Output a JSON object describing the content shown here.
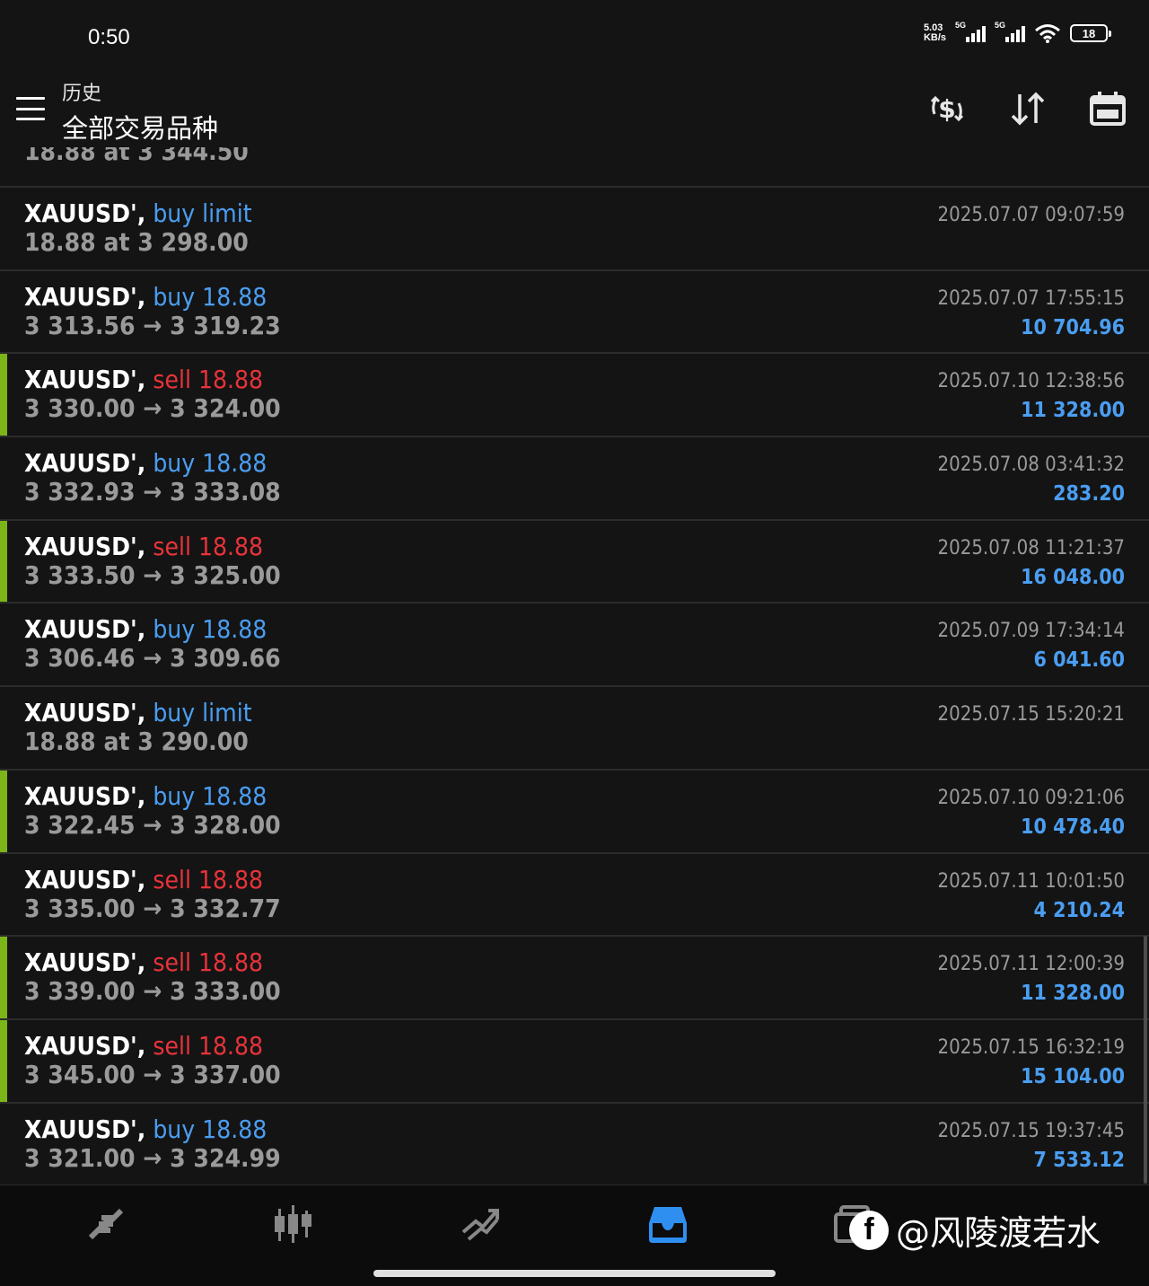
{
  "status_bar": {
    "time": "0:50",
    "net_speed_value": "5.03",
    "net_speed_unit": "KB/s",
    "network_1": "5G",
    "network_2": "5G",
    "battery": "18"
  },
  "header": {
    "subtitle": "历史",
    "title": "全部交易品种",
    "icons": [
      "menu-icon",
      "currency-exchange-icon",
      "sort-icon",
      "calendar-icon"
    ]
  },
  "partial_row": {
    "line2": "18.88 at 3 344.50"
  },
  "rows": [
    {
      "symbol": "XAUUSD',",
      "side": "buy limit",
      "side_type": "buy",
      "line2": "18.88 at 3 298.00",
      "time": "2025.07.07 09:07:59",
      "profit": "",
      "marked": false
    },
    {
      "symbol": "XAUUSD',",
      "side": "buy 18.88",
      "side_type": "buy",
      "line2": "3 313.56 → 3 319.23",
      "time": "2025.07.07 17:55:15",
      "profit": "10 704.96",
      "marked": false
    },
    {
      "symbol": "XAUUSD',",
      "side": "sell 18.88",
      "side_type": "sell",
      "line2": "3 330.00 → 3 324.00",
      "time": "2025.07.10 12:38:56",
      "profit": "11 328.00",
      "marked": true
    },
    {
      "symbol": "XAUUSD',",
      "side": "buy 18.88",
      "side_type": "buy",
      "line2": "3 332.93 → 3 333.08",
      "time": "2025.07.08 03:41:32",
      "profit": "283.20",
      "marked": false
    },
    {
      "symbol": "XAUUSD',",
      "side": "sell 18.88",
      "side_type": "sell",
      "line2": "3 333.50 → 3 325.00",
      "time": "2025.07.08 11:21:37",
      "profit": "16 048.00",
      "marked": true
    },
    {
      "symbol": "XAUUSD',",
      "side": "buy 18.88",
      "side_type": "buy",
      "line2": "3 306.46 → 3 309.66",
      "time": "2025.07.09 17:34:14",
      "profit": "6 041.60",
      "marked": false
    },
    {
      "symbol": "XAUUSD',",
      "side": "buy limit",
      "side_type": "buy",
      "line2": "18.88 at 3 290.00",
      "time": "2025.07.15 15:20:21",
      "profit": "",
      "marked": false
    },
    {
      "symbol": "XAUUSD',",
      "side": "buy 18.88",
      "side_type": "buy",
      "line2": "3 322.45 → 3 328.00",
      "time": "2025.07.10 09:21:06",
      "profit": "10 478.40",
      "marked": true
    },
    {
      "symbol": "XAUUSD',",
      "side": "sell 18.88",
      "side_type": "sell",
      "line2": "3 335.00 → 3 332.77",
      "time": "2025.07.11 10:01:50",
      "profit": "4 210.24",
      "marked": false
    },
    {
      "symbol": "XAUUSD',",
      "side": "sell 18.88",
      "side_type": "sell",
      "line2": "3 339.00 → 3 333.00",
      "time": "2025.07.11 12:00:39",
      "profit": "11 328.00",
      "marked": true
    },
    {
      "symbol": "XAUUSD',",
      "side": "sell 18.88",
      "side_type": "sell",
      "line2": "3 345.00 → 3 337.00",
      "time": "2025.07.15 16:32:19",
      "profit": "15 104.00",
      "marked": true
    },
    {
      "symbol": "XAUUSD',",
      "side": "buy 18.88",
      "side_type": "buy",
      "line2": "3 321.00 → 3 324.99",
      "time": "2025.07.15 19:37:45",
      "profit": "7 533.12",
      "marked": false
    }
  ],
  "bottom_nav": {
    "items": [
      "quotes-icon",
      "chart-icon",
      "trade-icon",
      "history-icon",
      "messages-icon"
    ],
    "active": "history-icon",
    "accent": "#2f8ff0"
  },
  "watermark": {
    "logo": "f",
    "text": "@风陵渡若水"
  },
  "colors": {
    "buy": "#4a9ef2",
    "sell": "#e8333a",
    "profit": "#4a9ef2",
    "marker": "#7cb518",
    "background": "#141414"
  }
}
